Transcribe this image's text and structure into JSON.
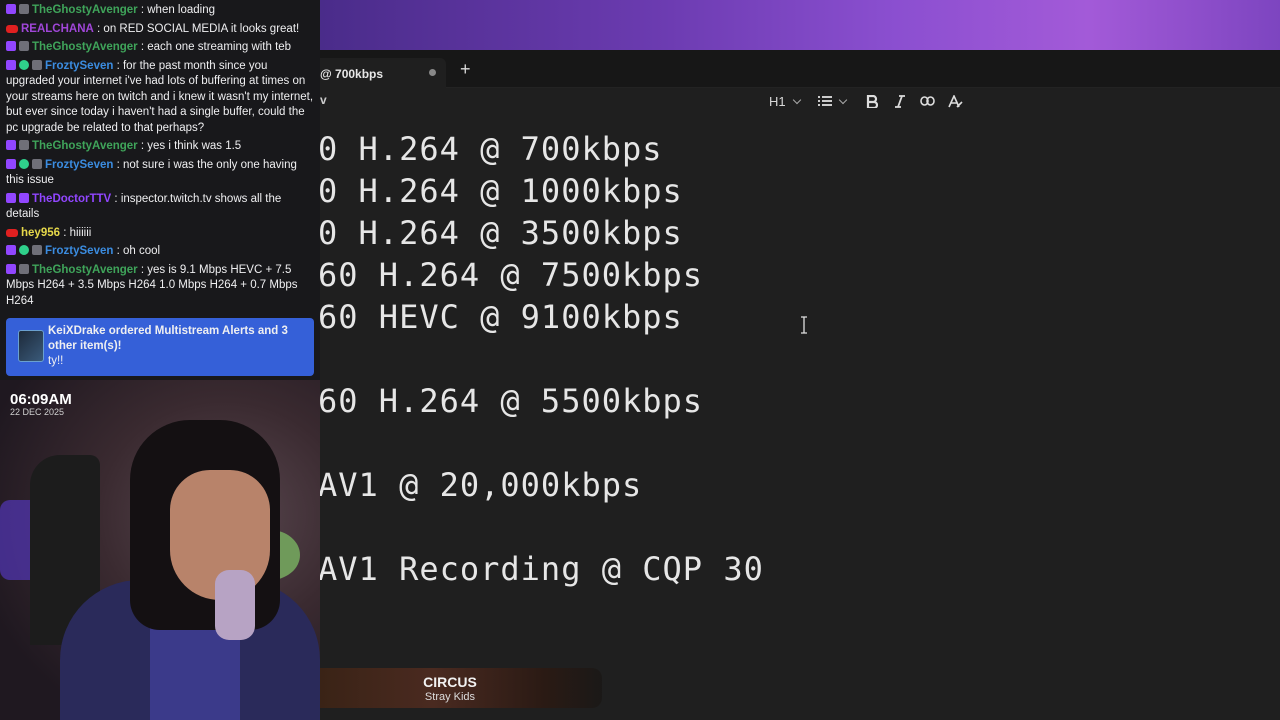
{
  "chat": {
    "messages": [
      {
        "user": "TheGhostyAvenger",
        "color": "#3fa45a",
        "text": " : when loading",
        "badges": [
          "sub",
          "gray"
        ]
      },
      {
        "user": "REALCHANA",
        "color": "#a046d8",
        "text": " : on RED SOCIAL MEDIA it looks great!",
        "badges": [
          "yt"
        ]
      },
      {
        "user": "TheGhostyAvenger",
        "color": "#3fa45a",
        "text": " : each one streaming with teb",
        "badges": [
          "sub",
          "gray"
        ]
      },
      {
        "user": "FroztySeven",
        "color": "#3b8ce0",
        "text": " : for the past month since you upgraded your internet i've had lots of buffering at times on your streams here on twitch and i knew it wasn't my internet, but ever since today i haven't had a single buffer, could the pc upgrade be related to that perhaps?",
        "badges": [
          "sub",
          "green",
          "gray"
        ]
      },
      {
        "user": "TheGhostyAvenger",
        "color": "#3fa45a",
        "text": " : yes i think was 1.5",
        "badges": [
          "sub",
          "gray"
        ]
      },
      {
        "user": "FroztySeven",
        "color": "#3b8ce0",
        "text": " : not sure i was the only one having this issue",
        "badges": [
          "sub",
          "green",
          "gray"
        ]
      },
      {
        "user": "TheDoctorTTV",
        "color": "#9146ff",
        "text": " : inspector.twitch.tv shows all the details",
        "badges": [
          "sub",
          "sub"
        ]
      },
      {
        "user": "hey956",
        "color": "#e6d84a",
        "text": " : hiiiiii",
        "badges": [
          "yt"
        ]
      },
      {
        "user": "FroztySeven",
        "color": "#3b8ce0",
        "text": " : oh cool",
        "badges": [
          "sub",
          "green",
          "gray"
        ]
      },
      {
        "user": "TheGhostyAvenger",
        "color": "#3fa45a",
        "text": " : yes is 9.1 Mbps HEVC + 7.5 Mbps H264 + 3.5 Mbps H264 1.0 Mbps H264 + 0.7 Mbps H264",
        "badges": [
          "sub",
          "gray"
        ]
      }
    ],
    "alert": {
      "title": "KeiXDrake ordered Multistream Alerts and 3 other item(s)!",
      "message": "ty!!"
    }
  },
  "webcam": {
    "time": "06:09AM",
    "date": "22 DEC 2025"
  },
  "editor": {
    "tab_label": "@ 700kbps",
    "add_tab": "+",
    "left_label": "v",
    "heading_select": "H1",
    "lines": [
      "0 H.264 @ 700kbps",
      "0 H.264 @ 1000kbps",
      "0 H.264 @ 3500kbps",
      "60 H.264 @ 7500kbps",
      "60 HEVC @ 9100kbps",
      "",
      "60 H.264 @ 5500kbps",
      "",
      "AV1 @ 20,000kbps",
      "",
      "AV1 Recording @ CQP 30"
    ]
  },
  "now_playing": {
    "title": "CIRCUS",
    "artist": "Stray Kids"
  },
  "icons": [
    "heading-dropdown-icon",
    "list-icon",
    "bold-icon",
    "italic-icon",
    "link-icon",
    "clear-format-icon",
    "text-cursor-icon"
  ]
}
